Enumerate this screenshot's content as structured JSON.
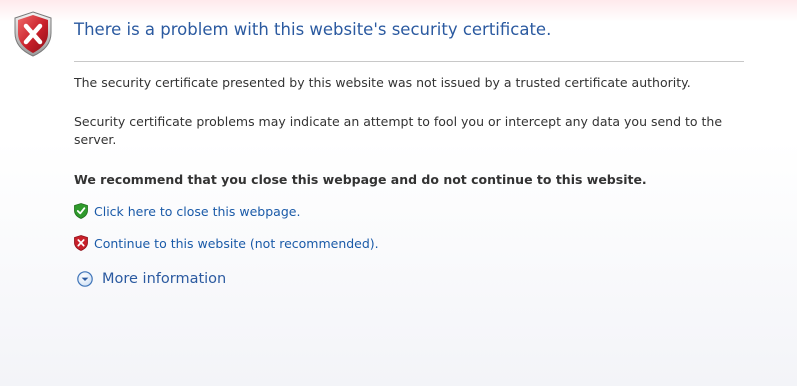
{
  "page": {
    "title": "There is a problem with this website's security certificate.",
    "paragraph1": "The security certificate presented by this website was not issued by a trusted certificate authority.",
    "paragraph2": "Security certificate problems may indicate an attempt to fool you or intercept any data you send to the server.",
    "recommendation": "We recommend that you close this webpage and do not continue to this website."
  },
  "actions": {
    "close": {
      "label": "Click here to close this webpage.",
      "icon": "green-shield-check-icon"
    },
    "continue": {
      "label": "Continue to this website (not recommended).",
      "icon": "red-shield-x-icon"
    },
    "more_info": {
      "label": "More information",
      "icon": "expand-circle-icon"
    }
  },
  "header_icon": "red-shield-x-icon",
  "colors": {
    "title": "#2b5aa0",
    "link": "#1a5aa8",
    "body_text": "#333333",
    "danger": "#c8202a",
    "safe": "#2f9a2c"
  }
}
